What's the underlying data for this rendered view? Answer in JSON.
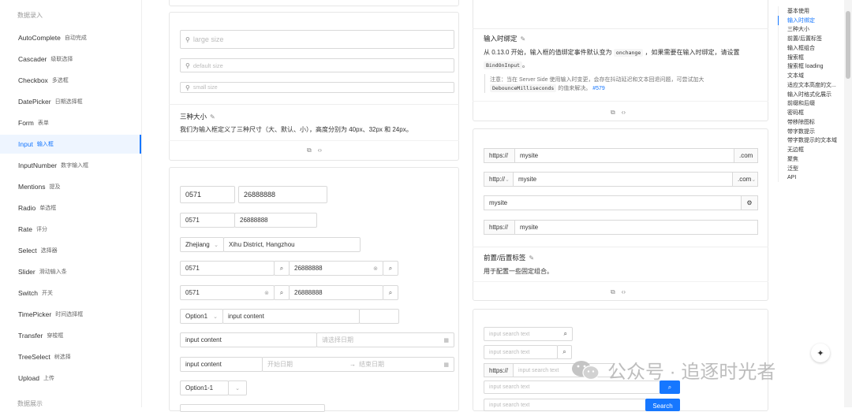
{
  "sidebar": {
    "group_top": "数据录入",
    "group_bottom": "数据展示",
    "items": [
      {
        "en": "AutoComplete",
        "zh": "自动完成"
      },
      {
        "en": "Cascader",
        "zh": "级联选择"
      },
      {
        "en": "Checkbox",
        "zh": "多选框"
      },
      {
        "en": "DatePicker",
        "zh": "日期选择框"
      },
      {
        "en": "Form",
        "zh": "表单"
      },
      {
        "en": "Input",
        "zh": "输入框"
      },
      {
        "en": "InputNumber",
        "zh": "数字输入框"
      },
      {
        "en": "Mentions",
        "zh": "提及"
      },
      {
        "en": "Radio",
        "zh": "单选框"
      },
      {
        "en": "Rate",
        "zh": "评分"
      },
      {
        "en": "Select",
        "zh": "选择器"
      },
      {
        "en": "Slider",
        "zh": "滑动输入条"
      },
      {
        "en": "Switch",
        "zh": "开关"
      },
      {
        "en": "TimePicker",
        "zh": "时间选择框"
      },
      {
        "en": "Transfer",
        "zh": "穿梭框"
      },
      {
        "en": "TreeSelect",
        "zh": "树选择"
      },
      {
        "en": "Upload",
        "zh": "上传"
      }
    ]
  },
  "sizes_demo": {
    "large_placeholder": "large size",
    "default_placeholder": "default size",
    "small_placeholder": "small size",
    "title": "三种大小",
    "desc": "我们为输入框定义了三种尺寸（大、默认、小），高度分别为 40px、32px 和 24px。"
  },
  "compact_demo": {
    "area_code": "0571",
    "phone": "26888888",
    "province": "Zhejiang",
    "address": "Xihu District, Hangzhou",
    "option1": "Option1",
    "input_content": "input content",
    "date_placeholder": "请选择日期",
    "start_date": "开始日期",
    "end_date": "结束日期",
    "cascade_value": "Option1-1"
  },
  "binding_demo": {
    "title": "输入时绑定",
    "desc_prefix": "从 0.13.0 开始，输入框的值绑定事件默认变为",
    "desc_code": "onchange",
    "desc_mid": "，如果需要在输入时绑定，请设置",
    "desc_code2": "BindOnInput",
    "desc_end": "。",
    "note_prefix": "注意：当在 Server Side 使用输入时变更，会存在抖动延迟和文本回退问题，可尝试加大",
    "note_code": "DebounceMilliseconds",
    "note_mid": "的值来解决。",
    "note_link": "#579"
  },
  "addon_demo": {
    "https": "https://",
    "http": "http://",
    "site": "mysite",
    "com": ".com",
    "title": "前置/后置标签",
    "desc": "用于配置一些固定组合。"
  },
  "search_demo": {
    "placeholder": "input search text",
    "https": "https://",
    "button": "Search"
  },
  "toc": {
    "items": [
      "基本使用",
      "输入时绑定",
      "三种大小",
      "前置/后置标签",
      "输入框组合",
      "搜索框",
      "搜索框 loading",
      "文本域",
      "适应文本高度的文...",
      "输入时格式化展示",
      "前缀和后缀",
      "密码框",
      "带移除图标",
      "带字数提示",
      "带字数提示的文本域",
      "无边框",
      "聚焦",
      "泛型",
      "API"
    ],
    "active_index": 1
  },
  "watermark": {
    "text": "公众号 · 追逐时光者"
  },
  "colors": {
    "primary": "#1677ff"
  },
  "icons": {
    "search": "⌕",
    "gear": "⚙",
    "copy": "⧉",
    "code": "‹›",
    "pencil": "✎",
    "calendar": "▦",
    "clear": "⊗",
    "user": "⚲",
    "arrow": "→",
    "chevron": "⌄"
  }
}
